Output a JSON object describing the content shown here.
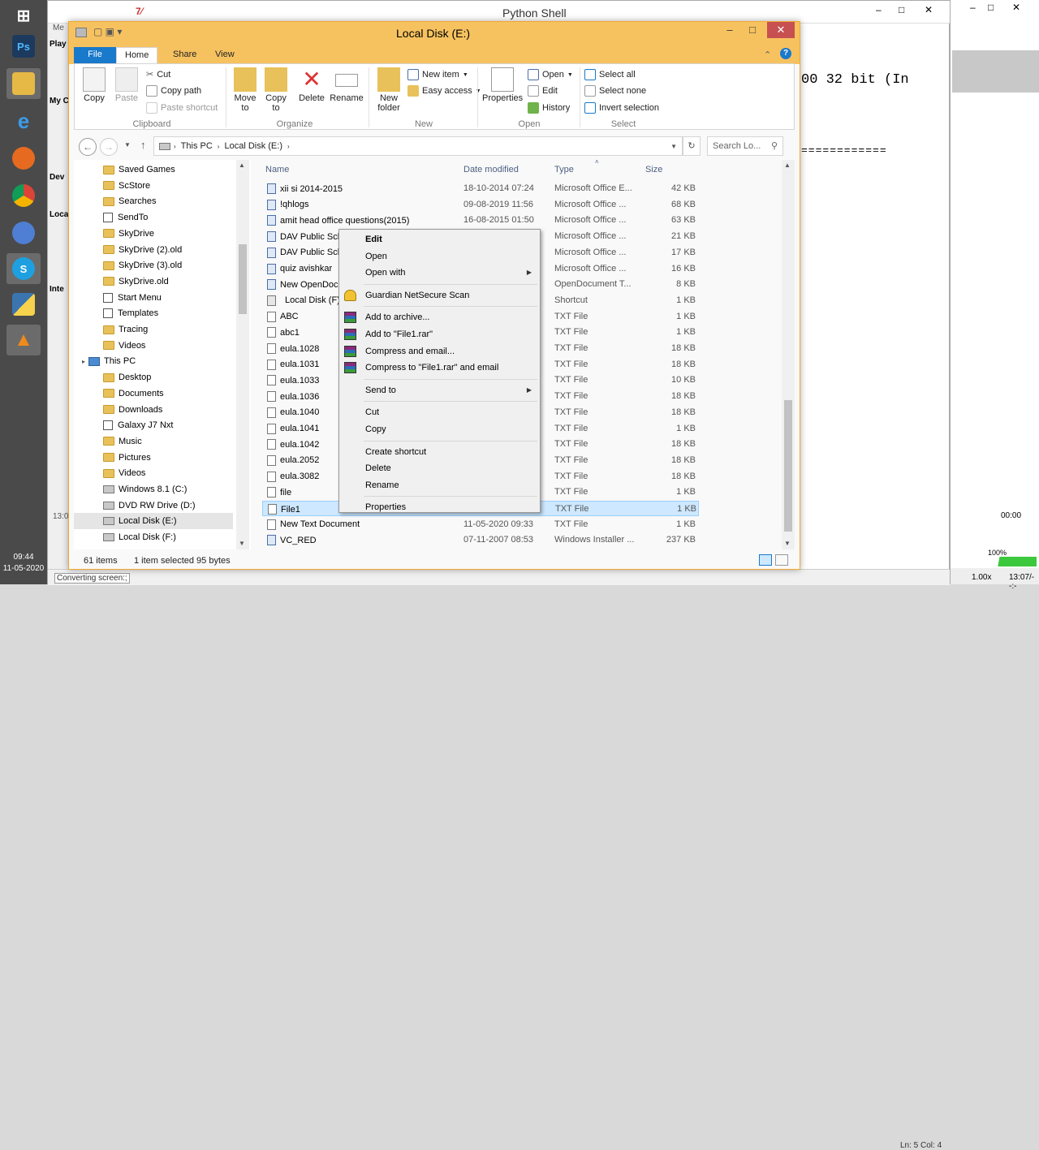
{
  "taskbar": {
    "time": "09:44",
    "date": "11-05-2020",
    "apps": [
      {
        "name": "windows-logo-icon"
      },
      {
        "name": "photoshop-icon",
        "label": "Ps"
      },
      {
        "name": "file-explorer-icon"
      },
      {
        "name": "internet-explorer-icon"
      },
      {
        "name": "firefox-icon"
      },
      {
        "name": "chrome-icon"
      },
      {
        "name": "chrome-canary-icon"
      },
      {
        "name": "skype-icon"
      },
      {
        "name": "python-idle-icon"
      },
      {
        "name": "vlc-icon"
      }
    ]
  },
  "python_shell": {
    "title": "Python Shell",
    "console_line1": "00 32 bit (In",
    "console_line2": "============",
    "left_fragments": [
      "Me",
      "Play",
      "My C",
      "Dev",
      "Loca",
      "Inte",
      "13:0"
    ],
    "status": "Converting screen:;",
    "line_col": "Ln: 5 Col: 4"
  },
  "right_window": {
    "time": "00:00",
    "zoom": "1.00x",
    "timecode": "13:07/--:-",
    "volume": "100%"
  },
  "explorer": {
    "title": "Local Disk (E:)",
    "tabs": [
      "File",
      "Home",
      "Share",
      "View"
    ],
    "ribbon": {
      "clipboard": {
        "label": "Clipboard",
        "copy": "Copy",
        "paste": "Paste",
        "cut": "Cut",
        "copy_path": "Copy path",
        "paste_shortcut": "Paste shortcut"
      },
      "organize": {
        "label": "Organize",
        "move_to": "Move to",
        "copy_to": "Copy to",
        "delete": "Delete",
        "rename": "Rename"
      },
      "new": {
        "label": "New",
        "new_folder": "New folder",
        "new_item": "New item",
        "easy_access": "Easy access"
      },
      "open": {
        "label": "Open",
        "properties": "Properties",
        "open": "Open",
        "edit": "Edit",
        "history": "History"
      },
      "select": {
        "label": "Select",
        "select_all": "Select all",
        "select_none": "Select none",
        "invert_selection": "Invert selection"
      }
    },
    "address": {
      "pc": "This PC",
      "drive": "Local Disk (E:)"
    },
    "search_placeholder": "Search Lo...",
    "nav_items": [
      {
        "label": "Saved Games",
        "icon": "folder"
      },
      {
        "label": "ScStore",
        "icon": "folder"
      },
      {
        "label": "Searches",
        "icon": "folder"
      },
      {
        "label": "SendTo",
        "icon": "link"
      },
      {
        "label": "SkyDrive",
        "icon": "folder"
      },
      {
        "label": "SkyDrive (2).old",
        "icon": "folder"
      },
      {
        "label": "SkyDrive (3).old",
        "icon": "folder"
      },
      {
        "label": "SkyDrive.old",
        "icon": "folder"
      },
      {
        "label": "Start Menu",
        "icon": "link"
      },
      {
        "label": "Templates",
        "icon": "link"
      },
      {
        "label": "Tracing",
        "icon": "folder"
      },
      {
        "label": "Videos",
        "icon": "folder"
      },
      {
        "label": "This PC",
        "icon": "pc",
        "top": true
      },
      {
        "label": "Desktop",
        "icon": "folder"
      },
      {
        "label": "Documents",
        "icon": "folder"
      },
      {
        "label": "Downloads",
        "icon": "folder"
      },
      {
        "label": "Galaxy J7 Nxt",
        "icon": "link"
      },
      {
        "label": "Music",
        "icon": "folder"
      },
      {
        "label": "Pictures",
        "icon": "folder"
      },
      {
        "label": "Videos",
        "icon": "folder"
      },
      {
        "label": "Windows 8.1 (C:)",
        "icon": "drive"
      },
      {
        "label": "DVD RW Drive (D:)",
        "icon": "drive"
      },
      {
        "label": "Local Disk (E:)",
        "icon": "drive",
        "selected": true
      },
      {
        "label": "Local Disk (F:)",
        "icon": "drive"
      }
    ],
    "columns": {
      "name": "Name",
      "date": "Date modified",
      "type": "Type",
      "size": "Size"
    },
    "files": [
      {
        "name": "xii si 2014-2015",
        "date": "18-10-2014 07:24",
        "type": "Microsoft Office E...",
        "size": "42 KB",
        "icon": "doc"
      },
      {
        "name": "!qhlogs",
        "date": "09-08-2019 11:56",
        "type": "Microsoft Office ...",
        "size": "68 KB",
        "icon": "doc"
      },
      {
        "name": "amit head office questions(2015)",
        "date": "16-08-2015 01:50",
        "type": "Microsoft Office ...",
        "size": "63 KB",
        "icon": "doc"
      },
      {
        "name": "DAV Public Sch",
        "date": "",
        "type": "Microsoft Office ...",
        "size": "21 KB",
        "icon": "doc"
      },
      {
        "name": "DAV Public Sch",
        "date": "",
        "type": "Microsoft Office ...",
        "size": "17 KB",
        "icon": "doc"
      },
      {
        "name": "quiz avishkar",
        "date": "",
        "type": "Microsoft Office ...",
        "size": "16 KB",
        "icon": "doc"
      },
      {
        "name": "New OpenDoc",
        "date": "",
        "type": "OpenDocument T...",
        "size": "8 KB",
        "icon": "doc"
      },
      {
        "name": "Local Disk (F)",
        "date": "",
        "type": "Shortcut",
        "size": "1 KB",
        "icon": "lnk"
      },
      {
        "name": "ABC",
        "date": "",
        "type": "TXT File",
        "size": "1 KB",
        "icon": "txt"
      },
      {
        "name": "abc1",
        "date": "",
        "type": "TXT File",
        "size": "1 KB",
        "icon": "txt"
      },
      {
        "name": "eula.1028",
        "date": "",
        "type": "TXT File",
        "size": "18 KB",
        "icon": "txt"
      },
      {
        "name": "eula.1031",
        "date": "",
        "type": "TXT File",
        "size": "18 KB",
        "icon": "txt"
      },
      {
        "name": "eula.1033",
        "date": "",
        "type": "TXT File",
        "size": "10 KB",
        "icon": "txt"
      },
      {
        "name": "eula.1036",
        "date": "",
        "type": "TXT File",
        "size": "18 KB",
        "icon": "txt"
      },
      {
        "name": "eula.1040",
        "date": "",
        "type": "TXT File",
        "size": "18 KB",
        "icon": "txt"
      },
      {
        "name": "eula.1041",
        "date": "",
        "type": "TXT File",
        "size": "1 KB",
        "icon": "txt"
      },
      {
        "name": "eula.1042",
        "date": "",
        "type": "TXT File",
        "size": "18 KB",
        "icon": "txt"
      },
      {
        "name": "eula.2052",
        "date": "",
        "type": "TXT File",
        "size": "18 KB",
        "icon": "txt"
      },
      {
        "name": "eula.3082",
        "date": "",
        "type": "TXT File",
        "size": "18 KB",
        "icon": "txt"
      },
      {
        "name": "file",
        "date": "",
        "type": "TXT File",
        "size": "1 KB",
        "icon": "txt"
      },
      {
        "name": "File1",
        "date": "",
        "type": "TXT File",
        "size": "1 KB",
        "icon": "txt",
        "selected": true
      },
      {
        "name": "New Text Document",
        "date": "11-05-2020 09:33",
        "type": "TXT File",
        "size": "1 KB",
        "icon": "txt"
      },
      {
        "name": "VC_RED",
        "date": "07-11-2007 08:53",
        "type": "Windows Installer ...",
        "size": "237 KB",
        "icon": "doc"
      }
    ],
    "status": {
      "count": "61 items",
      "selection": "1 item selected  95 bytes"
    }
  },
  "context_menu": {
    "items": [
      {
        "label": "Edit",
        "bold": true
      },
      {
        "label": "Open"
      },
      {
        "label": "Open with",
        "submenu": true
      },
      {
        "sep": true
      },
      {
        "label": "Guardian NetSecure Scan",
        "icon": "shield"
      },
      {
        "sep": true
      },
      {
        "label": "Add to archive...",
        "icon": "rar"
      },
      {
        "label": "Add to \"File1.rar\"",
        "icon": "rar"
      },
      {
        "label": "Compress and email...",
        "icon": "rar"
      },
      {
        "label": "Compress to \"File1.rar\" and email",
        "icon": "rar"
      },
      {
        "sep": true
      },
      {
        "label": "Send to",
        "submenu": true
      },
      {
        "sep": true
      },
      {
        "label": "Cut"
      },
      {
        "label": "Copy"
      },
      {
        "sep": true
      },
      {
        "label": "Create shortcut"
      },
      {
        "label": "Delete"
      },
      {
        "label": "Rename"
      },
      {
        "sep": true
      },
      {
        "label": "Properties"
      }
    ]
  }
}
